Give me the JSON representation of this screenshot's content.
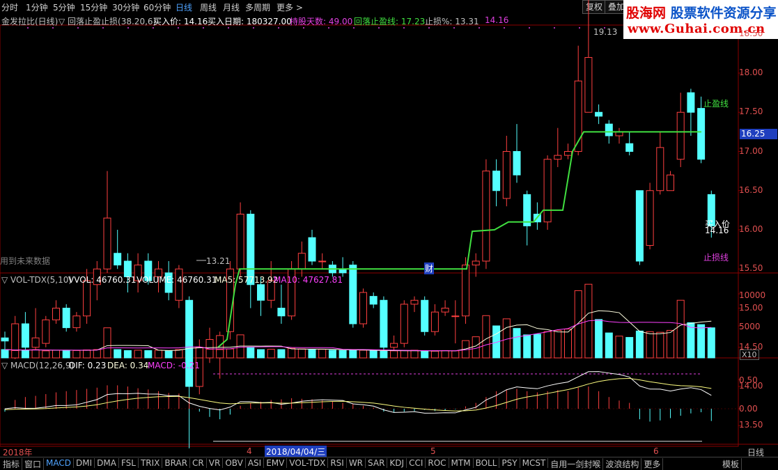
{
  "topbar": {
    "tabs": [
      "分时",
      "1分钟",
      "5分钟",
      "15分钟",
      "30分钟",
      "60分钟",
      "日线",
      "周线",
      "月线",
      "多周期",
      "更多 >"
    ],
    "active_tab": "日线",
    "right_buttons": [
      "复权",
      "叠加"
    ]
  },
  "logo": {
    "line1_a": "股海网",
    "line1_b": "股票软件资源分享",
    "line2": "www.Guhai.com.cn"
  },
  "indicator_header": {
    "name": "金发拉比(日线)",
    "formula": "▽ 回落止盈止损(38.20,6)",
    "buy_price": "买入价: 14.16",
    "buy_date": "买入日期: 180327.00",
    "hold_days": "持股天数: 49.00",
    "trail_stop": "回落止盈线: 17.23",
    "stop_pct": "止损%: 13.31",
    "extra": "14.16"
  },
  "price_axis": {
    "labels": [
      "18.50",
      "18.00",
      "17.50",
      "17.00",
      "16.50",
      "16.00",
      "15.50",
      "15.00",
      "14.50",
      "14.00",
      "13.50"
    ],
    "current": "16.25"
  },
  "chart_labels": {
    "high": "19.13",
    "low": "13.21",
    "take_profit": "止盈线",
    "buy_label": "买入价",
    "buy_value": "14.16",
    "stop_loss": "止损线",
    "future_data": "用到未来数据",
    "finance_mark": "财"
  },
  "volume_header": {
    "name": "▽ VOL-TDX(5,10)",
    "vvol": "VVOL: 46760.31",
    "volume": "VOLUME: 46760.31",
    "ma5": "MA5: 57713.92",
    "ma10": "MA10: 47627.81"
  },
  "volume_axis": {
    "labels": [
      "10000",
      "5000"
    ],
    "unit": "X10"
  },
  "macd_header": {
    "name": "▽ MACD(12,26,9)",
    "dif": "DIF: 0.23",
    "dea": "DEA: 0.34",
    "macd": "MACD: -0.21"
  },
  "macd_axis": {
    "labels": [
      "0.50",
      "0.00"
    ]
  },
  "time_axis": {
    "labels": [
      "2018年",
      "4",
      "2018/04/04/三",
      "5",
      "6"
    ],
    "period": "日线"
  },
  "bottom_tabs": [
    "指标",
    "窗口",
    "MACD",
    "DMI",
    "DMA",
    "FSL",
    "TRIX",
    "BRAR",
    "CR",
    "VR",
    "OBV",
    "ASI",
    "EMV",
    "VOL-TDX",
    "RSI",
    "WR",
    "SAR",
    "KDJ",
    "CCI",
    "ROC",
    "MTM",
    "BOLL",
    "PSY",
    "MCST",
    "自用一剑封喉",
    "波浪结构",
    "更多",
    "模板"
  ],
  "colors": {
    "up": "#ff4040",
    "down": "#54ffff",
    "trail_line": "#40e040",
    "grid": "#8b0000",
    "ma5": "#ffffe0",
    "ma10": "#ff40ff",
    "magenta": "#e040e0",
    "green_text": "#40e040",
    "accent": "#4fa3ff"
  },
  "candles": [
    [
      14.62,
      14.58,
      14.7,
      14.45
    ],
    [
      14.45,
      14.8,
      14.9,
      14.35
    ],
    [
      14.8,
      14.5,
      14.95,
      14.4
    ],
    [
      14.5,
      14.62,
      15.0,
      14.45
    ],
    [
      14.55,
      14.85,
      14.9,
      14.5
    ],
    [
      14.85,
      15.0,
      15.1,
      14.8
    ],
    [
      15.0,
      14.75,
      15.05,
      14.7
    ],
    [
      14.75,
      14.9,
      14.95,
      14.7
    ],
    [
      14.9,
      15.35,
      15.5,
      14.8
    ],
    [
      15.3,
      15.5,
      15.6,
      15.1
    ],
    [
      15.5,
      16.15,
      16.75,
      15.45
    ],
    [
      15.7,
      15.55,
      16.0,
      15.5
    ],
    [
      15.6,
      15.4,
      15.7,
      15.2
    ],
    [
      15.35,
      15.55,
      15.7,
      15.2
    ],
    [
      15.6,
      15.35,
      15.7,
      15.3
    ],
    [
      15.4,
      15.5,
      15.6,
      15.2
    ],
    [
      15.45,
      15.2,
      15.6,
      15.1
    ],
    [
      15.1,
      15.5,
      15.55,
      15.0
    ],
    [
      15.1,
      14.0,
      15.15,
      13.21
    ],
    [
      14.0,
      14.5,
      14.6,
      13.9
    ],
    [
      14.45,
      14.6,
      14.75,
      14.3
    ],
    [
      14.45,
      14.65,
      14.7,
      14.1
    ],
    [
      14.7,
      15.5,
      15.6,
      14.6
    ],
    [
      15.5,
      16.2,
      16.35,
      15.4
    ],
    [
      16.2,
      15.3,
      16.25,
      15.0
    ],
    [
      15.3,
      15.1,
      15.4,
      14.9
    ],
    [
      15.1,
      15.35,
      15.6,
      15.0
    ],
    [
      15.0,
      14.9,
      15.3,
      14.8
    ],
    [
      14.9,
      15.5,
      15.6,
      14.85
    ],
    [
      15.5,
      15.7,
      15.85,
      15.4
    ],
    [
      15.9,
      15.6,
      16.0,
      15.55
    ],
    [
      15.6,
      15.6,
      15.7,
      15.5
    ],
    [
      15.55,
      15.45,
      15.6,
      15.4
    ],
    [
      15.5,
      15.45,
      15.65,
      15.4
    ],
    [
      15.55,
      14.8,
      15.6,
      14.75
    ],
    [
      14.8,
      15.2,
      15.25,
      14.75
    ],
    [
      15.15,
      15.05,
      15.2,
      15.0
    ],
    [
      15.1,
      14.5,
      15.15,
      14.45
    ],
    [
      14.5,
      14.55,
      14.65,
      14.45
    ],
    [
      14.55,
      15.05,
      15.1,
      14.5
    ],
    [
      15.05,
      15.1,
      15.15,
      14.95
    ],
    [
      15.1,
      14.7,
      15.15,
      14.65
    ],
    [
      14.7,
      14.95,
      15.05,
      14.65
    ],
    [
      14.95,
      15.0,
      15.1,
      14.9
    ],
    [
      14.9,
      14.9,
      15.1,
      14.55
    ],
    [
      14.9,
      15.55,
      15.65,
      14.8
    ],
    [
      15.55,
      15.6,
      15.7,
      15.4
    ],
    [
      15.6,
      16.75,
      16.9,
      15.5
    ],
    [
      16.75,
      16.5,
      16.9,
      16.3
    ],
    [
      16.4,
      17.0,
      17.2,
      16.3
    ],
    [
      17.0,
      16.7,
      17.35,
      16.6
    ],
    [
      16.45,
      16.05,
      16.5,
      15.8
    ],
    [
      16.2,
      16.1,
      16.35,
      16.0
    ],
    [
      16.1,
      16.9,
      16.95,
      16.0
    ],
    [
      16.9,
      16.95,
      17.3,
      16.8
    ],
    [
      16.95,
      17.0,
      17.1,
      16.9
    ],
    [
      17.0,
      17.9,
      18.35,
      16.95
    ],
    [
      17.5,
      18.2,
      19.13,
      17.5
    ],
    [
      17.5,
      17.45,
      17.6,
      17.35
    ],
    [
      17.35,
      17.2,
      17.4,
      17.1
    ],
    [
      17.2,
      17.25,
      17.3,
      17.1
    ],
    [
      17.1,
      17.0,
      17.25,
      16.95
    ],
    [
      16.5,
      15.6,
      16.5,
      15.55
    ],
    [
      15.8,
      16.5,
      16.6,
      15.75
    ],
    [
      16.5,
      17.05,
      17.25,
      16.45
    ],
    [
      16.5,
      16.7,
      16.75,
      16.5
    ],
    [
      16.9,
      17.5,
      17.75,
      16.8
    ],
    [
      17.75,
      17.5,
      17.8,
      17.2
    ],
    [
      17.55,
      16.9,
      17.7,
      16.85
    ],
    [
      16.45,
      16.05,
      16.5,
      15.9
    ]
  ],
  "volumes": [
    1300,
    1150,
    1250,
    1300,
    1100,
    1200,
    1200,
    1150,
    1250,
    1300,
    4700,
    1300,
    1150,
    1200,
    1150,
    1200,
    1100,
    1300,
    2700,
    1600,
    1350,
    1300,
    1400,
    3600,
    1600,
    1300,
    1350,
    1300,
    1500,
    1400,
    1300,
    1350,
    1200,
    1150,
    1250,
    1200,
    1100,
    1050,
    1100,
    1150,
    1200,
    1000,
    1050,
    1150,
    1100,
    2700,
    3300,
    6600,
    5000,
    6100,
    4600,
    3600,
    3700,
    4100,
    4300,
    4500,
    10500,
    11500,
    6000,
    3900,
    3400,
    3200,
    4200,
    4100,
    4000,
    4300,
    9000,
    5500,
    5200,
    4700
  ],
  "macd_hist": [
    -0.05,
    0.15,
    0.2,
    0.22,
    0.25,
    0.28,
    0.3,
    0.32,
    0.34,
    0.36,
    0.4,
    0.4,
    0.38,
    0.35,
    0.33,
    0.3,
    0.27,
    0.26,
    0.18,
    -0.05,
    -0.14,
    -0.18,
    -0.1,
    0.05,
    0.1,
    0.12,
    0.15,
    0.16,
    0.18,
    0.17,
    0.16,
    0.14,
    0.12,
    0.1,
    0.08,
    0.05,
    0.02,
    -0.05,
    -0.06,
    -0.05,
    -0.04,
    -0.02,
    -0.04,
    -0.03,
    -0.01,
    0.04,
    0.1,
    0.2,
    0.3,
    0.32,
    0.34,
    0.3,
    0.28,
    0.3,
    0.32,
    0.3,
    0.36,
    0.38,
    0.3,
    0.2,
    0.14,
    0.1,
    -0.18,
    -0.22,
    -0.2,
    -0.16,
    -0.12,
    -0.08,
    -0.06,
    -0.21
  ]
}
